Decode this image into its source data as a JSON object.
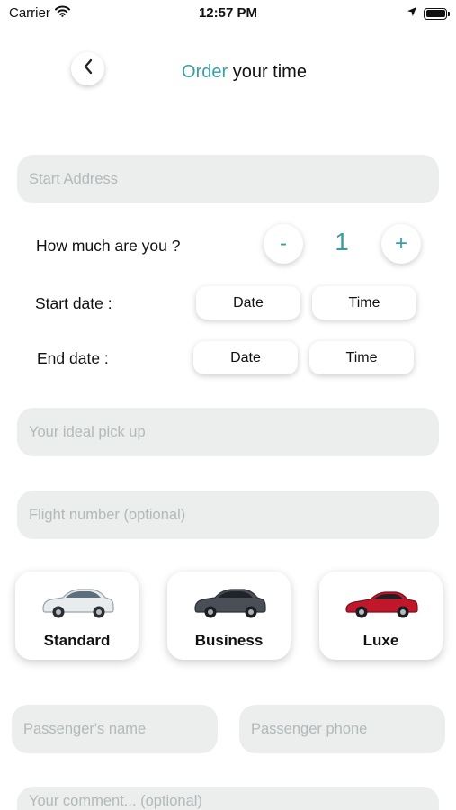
{
  "status_bar": {
    "carrier": "Carrier",
    "time": "12:57 PM"
  },
  "header": {
    "title_accent": "Order",
    "title_rest": "your time"
  },
  "form": {
    "start_address": {
      "placeholder": "Start Address",
      "value": ""
    },
    "passenger_count": {
      "label": "How much are you ?",
      "value": "1",
      "decrement_label": "-",
      "increment_label": "+"
    },
    "start_date": {
      "label": "Start date :",
      "date_label": "Date",
      "time_label": "Time"
    },
    "end_date": {
      "label": "End date :",
      "date_label": "Date",
      "time_label": "Time"
    },
    "pickup": {
      "placeholder": "Your ideal pick up",
      "value": ""
    },
    "flight_number": {
      "placeholder": "Flight number (optional)",
      "value": ""
    },
    "car_options": [
      {
        "label": "Standard",
        "color": "#e9ecee"
      },
      {
        "label": "Business",
        "color": "#4a4f57"
      },
      {
        "label": "Luxe",
        "color": "#c0172b"
      }
    ],
    "passenger_name": {
      "placeholder": "Passenger's name",
      "value": ""
    },
    "passenger_phone": {
      "placeholder": "Passenger phone",
      "value": ""
    },
    "comment": {
      "placeholder": "Your comment... (optional)",
      "value": ""
    }
  },
  "colors": {
    "accent": "#3a9ea0",
    "field_background": "#eceeee"
  }
}
